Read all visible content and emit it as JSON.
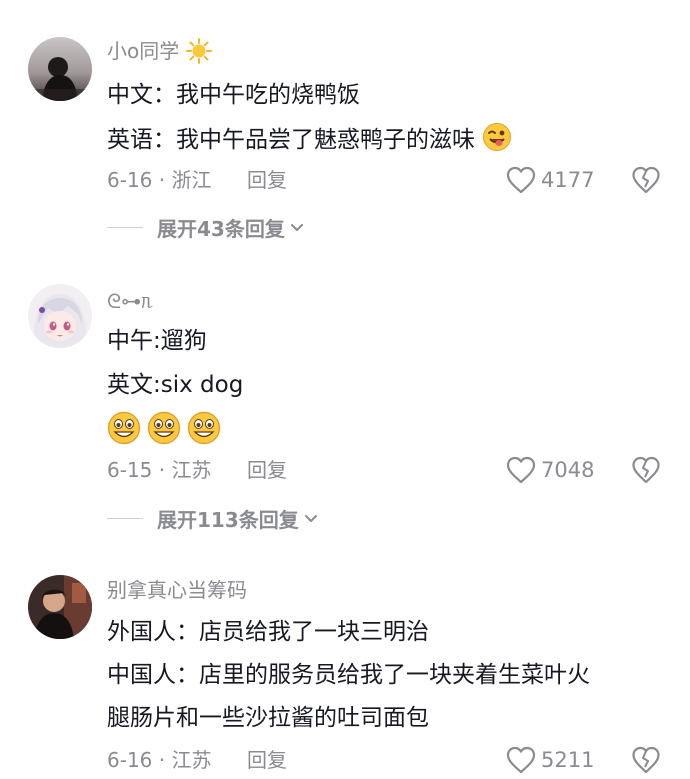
{
  "comments": [
    {
      "username": "小o同学",
      "lines": [
        "中文：我中午吃的烧鸭饭",
        "英语：我中午品尝了魅惑鸭子的滋味"
      ],
      "date_location": "6-16 · 浙江",
      "reply_label": "回复",
      "likes": "4177",
      "expand_label": "展开43条回复"
    },
    {
      "username": "ᘓ⊶ᥰ",
      "lines": [
        "中午:遛狗",
        "英文:six dog"
      ],
      "date_location": "6-15 · 江苏",
      "reply_label": "回复",
      "likes": "7048",
      "expand_label": "展开113条回复"
    },
    {
      "username": "别拿真心当筹码",
      "lines": [
        "外国人：店员给我了一块三明治",
        "中国人：店里的服务员给我了一块夹着生菜叶火",
        "腿肠片和一些沙拉酱的吐司面包"
      ],
      "date_location": "6-16 · 江苏",
      "reply_label": "回复",
      "likes": "5211"
    }
  ],
  "colors": {
    "text": "#161823",
    "meta": "#8a8b91",
    "divider": "#d0d1d4"
  },
  "icons": {
    "like": "heart-outline-icon",
    "dislike": "broken-heart-icon",
    "expand": "chevron-down-icon",
    "sun_emoji": "sun-emoji",
    "wink_emoji": "wink-tongue-emoji",
    "grin_emoji": "grin-emoji"
  }
}
